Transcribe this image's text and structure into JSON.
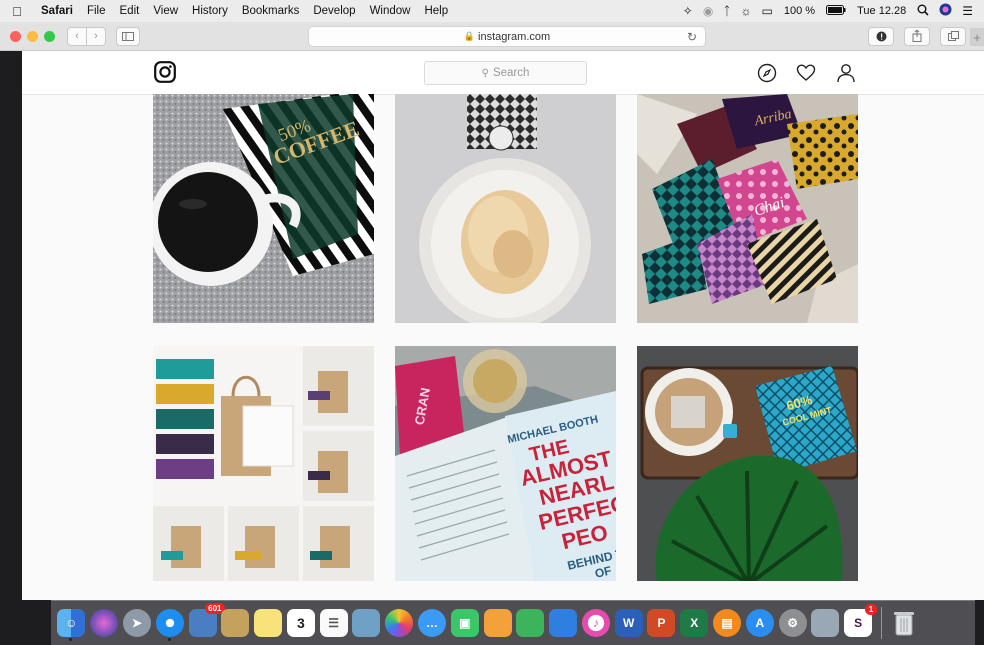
{
  "menubar": {
    "app_name": "Safari",
    "items": [
      "File",
      "Edit",
      "View",
      "History",
      "Bookmarks",
      "Develop",
      "Window",
      "Help"
    ],
    "battery": "100 %",
    "clock": "Tue 12.28"
  },
  "toolbar": {
    "url": "instagram.com"
  },
  "instagram": {
    "search_placeholder": "Search"
  },
  "photos": [
    {
      "subject": "black coffee cup with striped 50% coffee chocolate bar"
    },
    {
      "subject": "plate with shaved chocolate and patterned wrapper"
    },
    {
      "subject": "assorted patterned chocolate bars on fur"
    },
    {
      "subject": "chocolate bar gift bags grid"
    },
    {
      "subject": "book The Almost Nearly Perfect People with drink"
    },
    {
      "subject": "tea cup with 60% cool mint chocolate and monstera leaf"
    }
  ],
  "photo_text": {
    "photo1_line1": "50%",
    "photo1_line2": "COFFEE",
    "photo3_label1": "Arriba",
    "photo3_label2": "Chai",
    "photo5_author": "MICHAEL BOOTH",
    "photo5_title1": "THE",
    "photo5_title2": "ALMOST",
    "photo5_title3": "NEARL",
    "photo5_title4": "PERFEC",
    "photo5_title5": "PEO",
    "photo5_sub1": "BEHIND T",
    "photo5_sub2": "OF",
    "photo5_can": "CRAN",
    "photo6_line1": "60%",
    "photo6_line2": "COOL MINT"
  },
  "dock": {
    "badge_mail": "601",
    "calendar_day": "3",
    "badges": [
      "1"
    ],
    "icons": [
      "finder-icon",
      "siri-icon",
      "launchpad-icon",
      "safari-icon",
      "photos-slideshow-icon",
      "notes-icon",
      "stickies-icon",
      "calendar-icon",
      "reminders-icon",
      "preview-icon",
      "photos-icon",
      "messages-icon",
      "facetime-icon",
      "pages-icon",
      "numbers-icon",
      "keynote-icon",
      "itunes-icon",
      "word-icon",
      "powerpoint-icon",
      "excel-icon",
      "ibooks-icon",
      "app-store-icon",
      "system-preferences-icon",
      "image-capture-icon",
      "slack-icon",
      "trash-icon"
    ]
  },
  "colors": {
    "menubar": "#ececec",
    "toolbar": "#e2e2e2",
    "close": "#fc605c",
    "minimize": "#fdbc40",
    "zoom": "#34c84a",
    "page_bg": "#fafafa"
  }
}
